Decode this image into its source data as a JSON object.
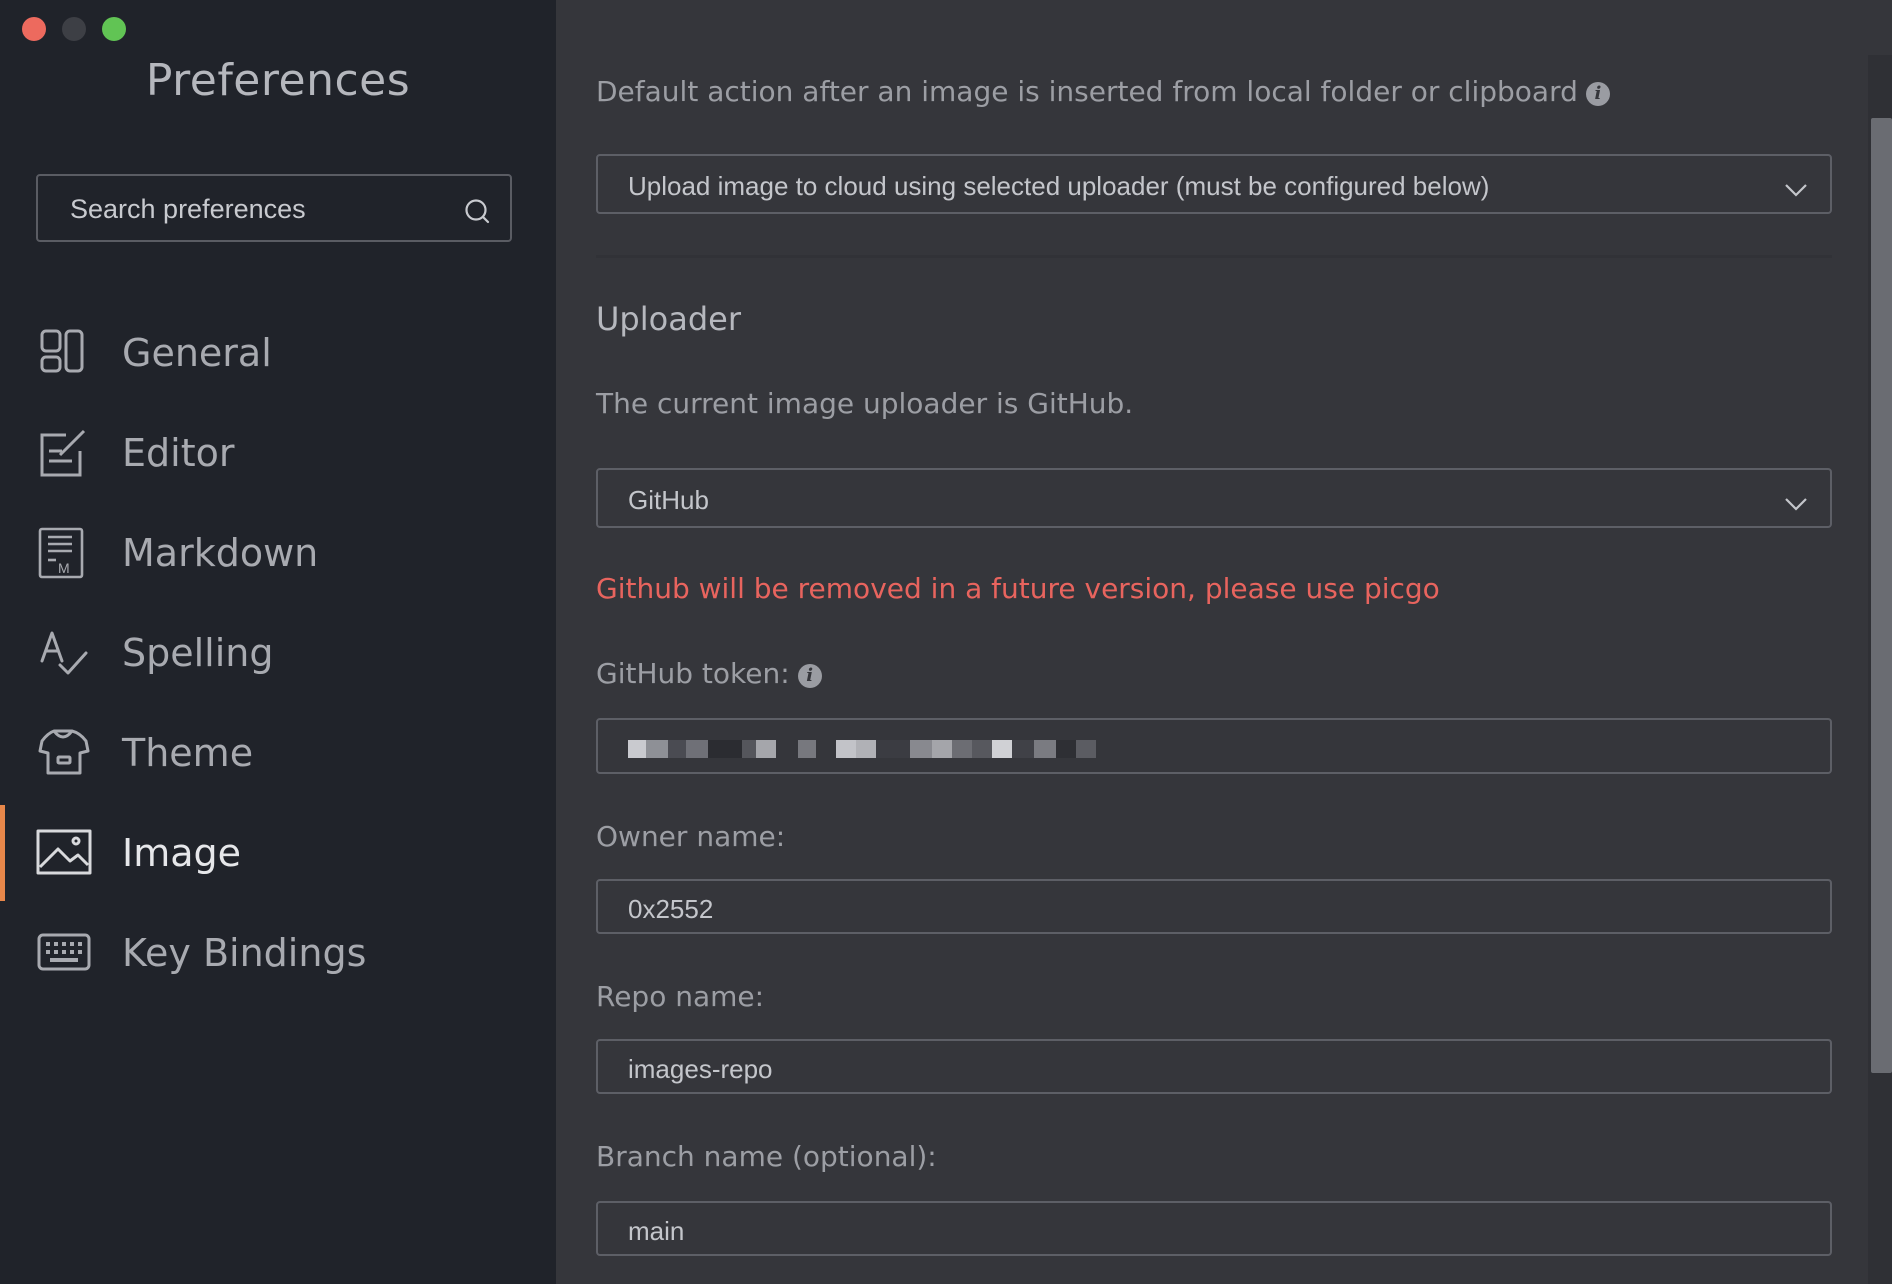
{
  "window": {
    "title": "Preferences"
  },
  "sidebar": {
    "search_placeholder": "Search preferences",
    "items": [
      {
        "label": "General",
        "icon": "general-icon"
      },
      {
        "label": "Editor",
        "icon": "editor-icon"
      },
      {
        "label": "Markdown",
        "icon": "markdown-icon"
      },
      {
        "label": "Spelling",
        "icon": "spelling-icon"
      },
      {
        "label": "Theme",
        "icon": "theme-icon"
      },
      {
        "label": "Image",
        "icon": "image-icon",
        "active": true
      },
      {
        "label": "Key Bindings",
        "icon": "keyboard-icon"
      }
    ]
  },
  "main": {
    "default_action_label": "Default action after an image is inserted from local folder or clipboard",
    "default_action_value": "Upload image to cloud using selected uploader (must be configured below)",
    "uploader_heading": "Uploader",
    "uploader_current": "The current image uploader is GitHub.",
    "uploader_value": "GitHub",
    "warning": "Github will be removed in a future version, please use picgo",
    "token_label": "GitHub token:",
    "owner_label": "Owner name:",
    "owner_value": "0x2552",
    "repo_label": "Repo name:",
    "repo_value": "images-repo",
    "branch_label": "Branch name (optional):",
    "branch_value": "main"
  },
  "colors": {
    "accent": "#e8874a",
    "warning": "#e8645e",
    "sidebar_bg": "#20232a",
    "main_bg": "#35363b"
  }
}
